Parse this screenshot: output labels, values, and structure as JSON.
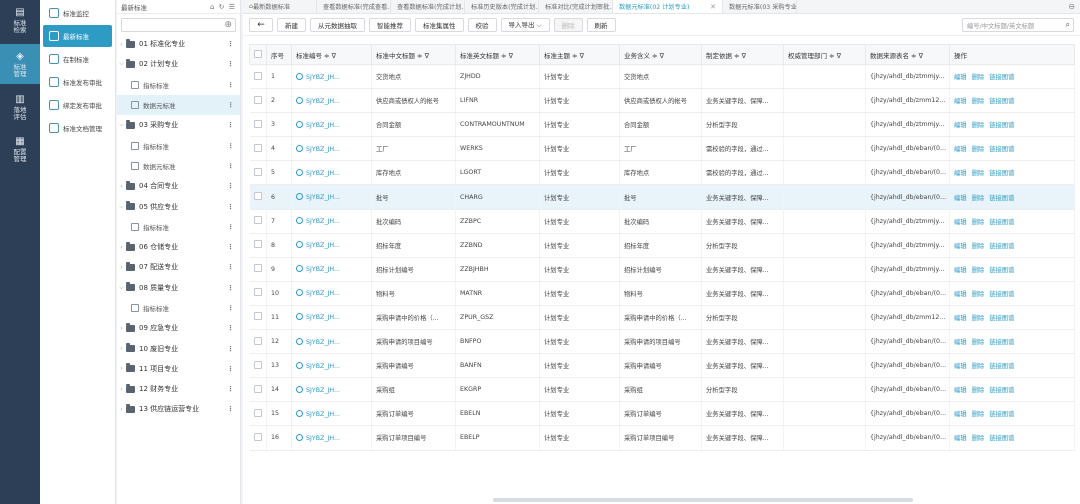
{
  "rail": [
    {
      "label": "标准\n检索",
      "icon": "search-doc-icon"
    },
    {
      "label": "标准\n管理",
      "icon": "manage-icon"
    },
    {
      "label": "落地\n评估",
      "icon": "chart-icon"
    },
    {
      "label": "配置\n管理",
      "icon": "config-icon"
    }
  ],
  "menu": [
    {
      "label": "标准监控"
    },
    {
      "label": "最新标准"
    },
    {
      "label": "在制标准"
    },
    {
      "label": "标准发布审批"
    },
    {
      "label": "绑定发布审批"
    },
    {
      "label": "标准文档管理"
    }
  ],
  "tree": {
    "title": "最新标准",
    "tools": "⌂ ↻ ☰",
    "nodes": [
      {
        "label": "01 标准化专业",
        "expanded": false,
        "leaf": false
      },
      {
        "label": "02 计划专业",
        "expanded": true,
        "leaf": false
      },
      {
        "label": "指标标准",
        "leaf": true
      },
      {
        "label": "数据元标准",
        "leaf": true,
        "selected": true
      },
      {
        "label": "03 采购专业",
        "expanded": true,
        "leaf": false
      },
      {
        "label": "指标标准",
        "leaf": true
      },
      {
        "label": "数据元标准",
        "leaf": true
      },
      {
        "label": "04 合同专业",
        "expanded": false,
        "leaf": false
      },
      {
        "label": "05 供应专业",
        "expanded": true,
        "leaf": false
      },
      {
        "label": "指标标准",
        "leaf": true
      },
      {
        "label": "06 仓储专业",
        "expanded": false,
        "leaf": false
      },
      {
        "label": "07 配送专业",
        "expanded": false,
        "leaf": false
      },
      {
        "label": "08 质量专业",
        "expanded": true,
        "leaf": false
      },
      {
        "label": "指标标准",
        "leaf": true
      },
      {
        "label": "09 应急专业",
        "expanded": false,
        "leaf": false
      },
      {
        "label": "10 废旧专业",
        "expanded": false,
        "leaf": false
      },
      {
        "label": "11 项目专业",
        "expanded": false,
        "leaf": false
      },
      {
        "label": "12 财务专业",
        "expanded": false,
        "leaf": false
      },
      {
        "label": "13 供应链运营专业",
        "expanded": false,
        "leaf": false
      }
    ]
  },
  "tabs": [
    {
      "label": "最新数据标准",
      "home": true
    },
    {
      "label": "查看数据标准(完成查看..."
    },
    {
      "label": "查看数据标准(完成计划..."
    },
    {
      "label": "标准历史版本(完成计划..."
    },
    {
      "label": "标准对比(完成计划审批..."
    },
    {
      "label": "数据元标准(02 计划专业)",
      "active": true
    },
    {
      "label": "数据元标准(03 采购专业)"
    }
  ],
  "toolbar": {
    "buttons": [
      "新建",
      "从元数据抽取",
      "智能推荐",
      "标准集属性",
      "校验",
      "导入导出 ⌵",
      "删除",
      "刷新"
    ],
    "search_placeholder": "编号/中文标题/英文标题"
  },
  "table": {
    "columns": [
      "序号",
      "标准编号 ≑ ∇",
      "标准中文标题 ≑ ∇",
      "标准英文标题 ≑ ∇",
      "标准主题 ≑ ∇",
      "业务含义 ≑ ∇",
      "制定依据 ≑ ∇",
      "权威管理部门 ≑ ∇",
      "数据来源表名 ≑ ∇",
      "操作"
    ],
    "ops": [
      "编辑",
      "删除",
      "链接图谱"
    ],
    "rows": [
      {
        "no": "1",
        "code": "SJYBZ_JH...",
        "cn": "交货地点",
        "en": "ZJHDD",
        "topic": "计划专业",
        "meaning": "交货地点",
        "basis": "",
        "dept": "",
        "src": "{jhzy/ahdl_db/ztmmjy..."
      },
      {
        "no": "2",
        "code": "SJYBZ_JH...",
        "cn": "供应商或债权人的帐号",
        "en": "LIFNR",
        "topic": "计划专业",
        "meaning": "供应商或债权人的帐号",
        "basis": "业务关键字段、保障...",
        "dept": "",
        "src": "{jhzy/ahdl_db/zmm12..."
      },
      {
        "no": "3",
        "code": "SJYBZ_JH...",
        "cn": "合同金额",
        "en": "CONTRAMOUNTNUM",
        "topic": "计划专业",
        "meaning": "合同金额",
        "basis": "分析型字段",
        "dept": "",
        "src": "{jhzy/ahdl_db/ztmmjy..."
      },
      {
        "no": "4",
        "code": "SJYBZ_JH...",
        "cn": "工厂",
        "en": "WERKS",
        "topic": "计划专业",
        "meaning": "工厂",
        "basis": "需校验的字段，通过...",
        "dept": "",
        "src": "{jhzy/ahdl_db/eban/(0..."
      },
      {
        "no": "5",
        "code": "SJYBZ_JH...",
        "cn": "库存地点",
        "en": "LGORT",
        "topic": "计划专业",
        "meaning": "库存地点",
        "basis": "需校验的字段，通过...",
        "dept": "",
        "src": "{jhzy/ahdl_db/eban/(0..."
      },
      {
        "no": "6",
        "code": "SJYBZ_JH...",
        "cn": "批号",
        "en": "CHARG",
        "topic": "计划专业",
        "meaning": "批号",
        "basis": "业务关键字段、保障...",
        "dept": "",
        "src": "{jhzy/ahdl_db/eban/(0...",
        "hl": true
      },
      {
        "no": "7",
        "code": "SJYBZ_JH...",
        "cn": "批次编码",
        "en": "ZZBPC",
        "topic": "计划专业",
        "meaning": "批次编码",
        "basis": "业务关键字段、保障...",
        "dept": "",
        "src": "{jhzy/ahdl_db/ztmmjy..."
      },
      {
        "no": "8",
        "code": "SJYBZ_JH...",
        "cn": "招标年度",
        "en": "ZZBND",
        "topic": "计划专业",
        "meaning": "招标年度",
        "basis": "分析型字段",
        "dept": "",
        "src": "{jhzy/ahdl_db/ztmmjy..."
      },
      {
        "no": "9",
        "code": "SJYBZ_JH...",
        "cn": "招标计划编号",
        "en": "ZZBJHBH",
        "topic": "计划专业",
        "meaning": "招标计划编号",
        "basis": "业务关键字段、保障...",
        "dept": "",
        "src": "{jhzy/ahdl_db/ztmmjy..."
      },
      {
        "no": "10",
        "code": "SJYBZ_JH...",
        "cn": "物料号",
        "en": "MATNR",
        "topic": "计划专业",
        "meaning": "物料号",
        "basis": "业务关键字段、保障...",
        "dept": "",
        "src": "{jhzy/ahdl_db/eban/(0..."
      },
      {
        "no": "11",
        "code": "SJYBZ_JH...",
        "cn": "采购申请中的价格（...",
        "en": "ZPUR_GSZ",
        "topic": "计划专业",
        "meaning": "采购申请中的价格（...",
        "basis": "分析型字段",
        "dept": "",
        "src": "{jhzy/ahdl_db/zmm12..."
      },
      {
        "no": "12",
        "code": "SJYBZ_JH...",
        "cn": "采购申请的项目编号",
        "en": "BNFPO",
        "topic": "计划专业",
        "meaning": "采购申请的项目编号",
        "basis": "业务关键字段、保障...",
        "dept": "",
        "src": "{jhzy/ahdl_db/eban/(0..."
      },
      {
        "no": "13",
        "code": "SJYBZ_JH...",
        "cn": "采购申请编号",
        "en": "BANFN",
        "topic": "计划专业",
        "meaning": "采购申请编号",
        "basis": "业务关键字段、保障...",
        "dept": "",
        "src": "{jhzy/ahdl_db/eban/(0..."
      },
      {
        "no": "14",
        "code": "SJYBZ_JH...",
        "cn": "采购组",
        "en": "EKGRP",
        "topic": "计划专业",
        "meaning": "采购组",
        "basis": "分析型字段",
        "dept": "",
        "src": "{jhzy/ahdl_db/eban/(0..."
      },
      {
        "no": "15",
        "code": "SJYBZ_JH...",
        "cn": "采购订单编号",
        "en": "EBELN",
        "topic": "计划专业",
        "meaning": "采购订单编号",
        "basis": "业务关键字段、保障...",
        "dept": "",
        "src": "{jhzy/ahdl_db/eban/(0..."
      },
      {
        "no": "16",
        "code": "SJYBZ_JH...",
        "cn": "采购订单项目编号",
        "en": "EBELP",
        "topic": "计划专业",
        "meaning": "采购订单项目编号",
        "basis": "业务关键字段、保障...",
        "dept": "",
        "src": "{jhzy/ahdl_db/eban/(0..."
      }
    ]
  }
}
